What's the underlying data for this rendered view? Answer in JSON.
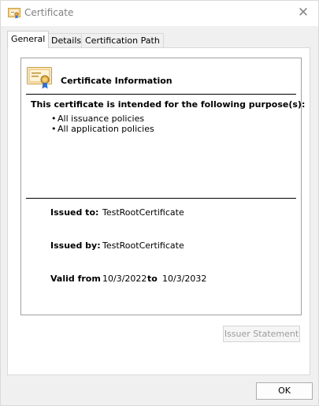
{
  "window": {
    "title": "Certificate",
    "close_glyph": "✕"
  },
  "tabs": [
    {
      "label": "General",
      "active": true
    },
    {
      "label": "Details",
      "active": false
    },
    {
      "label": "Certification Path",
      "active": false
    }
  ],
  "info": {
    "heading": "Certificate Information",
    "purpose_heading": "This certificate is intended for the following purpose(s):",
    "purposes": [
      "All issuance policies",
      "All application policies"
    ],
    "issued_to_label": "Issued to:",
    "issued_to_value": "TestRootCertificate",
    "issued_by_label": "Issued by:",
    "issued_by_value": "TestRootCertificate",
    "valid_from_label": "Valid from",
    "valid_from_value": "10/3/2022",
    "valid_to_label": "to",
    "valid_to_value": "10/3/2032"
  },
  "buttons": {
    "issuer_statement": "Issuer Statement",
    "ok": "OK"
  },
  "icons": {
    "title": "certificate-icon",
    "info": "certificate-ribbon-icon",
    "close": "close-icon"
  },
  "colors": {
    "title_text": "#808080",
    "disabled_text": "#9c9c9c",
    "cert_gold": "#e7b14a"
  }
}
